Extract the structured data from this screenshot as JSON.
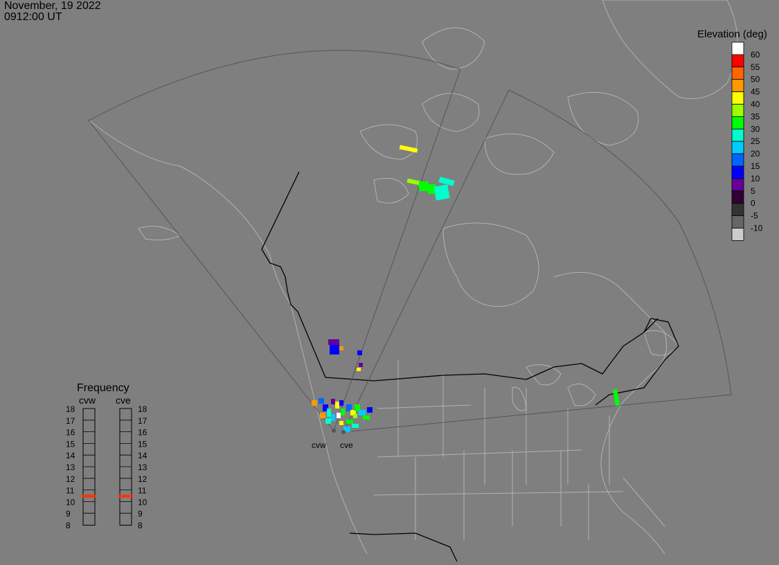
{
  "header": {
    "date": "November, 19 2022",
    "time": "0912:00 UT"
  },
  "legend": {
    "title": "Elevation (deg)",
    "entries": [
      {
        "label": "60",
        "color": "#ffffff"
      },
      {
        "label": "55",
        "color": "#ff0000"
      },
      {
        "label": "50",
        "color": "#ff6600"
      },
      {
        "label": "45",
        "color": "#ff9900"
      },
      {
        "label": "40",
        "color": "#ffff00"
      },
      {
        "label": "35",
        "color": "#99ff00"
      },
      {
        "label": "30",
        "color": "#00ff00"
      },
      {
        "label": "25",
        "color": "#00ffcc"
      },
      {
        "label": "20",
        "color": "#00ccff"
      },
      {
        "label": "15",
        "color": "#0066ff"
      },
      {
        "label": "10",
        "color": "#0000ff"
      },
      {
        "label": "5",
        "color": "#660099"
      },
      {
        "label": "0",
        "color": "#330033"
      },
      {
        "label": "-5",
        "color": "#333333"
      },
      {
        "label": "-10",
        "color": "#666666"
      },
      {
        "label": "",
        "color": "#cccccc"
      }
    ]
  },
  "frequency": {
    "title": "Frequency",
    "radars": [
      "cvw",
      "cve"
    ],
    "ticks": [
      "18",
      "17",
      "16",
      "15",
      "14",
      "13",
      "12",
      "11",
      "10",
      "9",
      "8"
    ],
    "current": {
      "cvw": 11,
      "cve": 11
    },
    "marker_color": "#ff3300"
  },
  "radar_sites": {
    "west_label": "cvw",
    "east_label": "cve"
  },
  "colors": {
    "background": "#7f7f7f",
    "coastline": "#b3b3b3",
    "border": "#000000",
    "fov": "#555555"
  }
}
